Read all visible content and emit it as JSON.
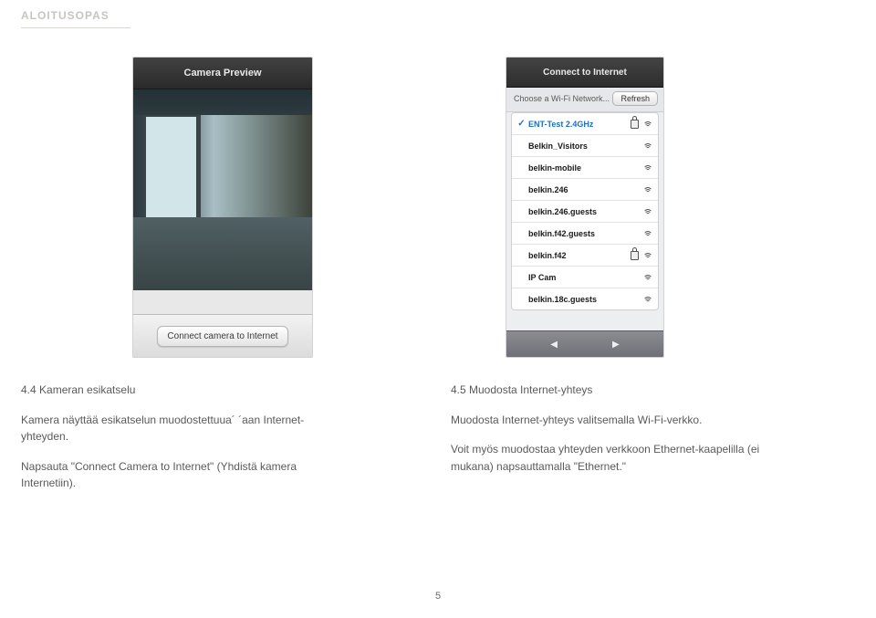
{
  "header": "ALOITUSOPAS",
  "pageNumber": "5",
  "leftShot": {
    "title": "Camera Preview",
    "button": "Connect camera to Internet"
  },
  "rightShot": {
    "title": "Connect to Internet",
    "chooseLabel": "Choose a Wi-Fi Network...",
    "refresh": "Refresh",
    "navPrev": "◀",
    "navNext": "▶",
    "networks": [
      {
        "name": "ENT-Test 2.4GHz",
        "selected": true,
        "lock": true
      },
      {
        "name": "Belkin_Visitors",
        "selected": false,
        "lock": false
      },
      {
        "name": "belkin-mobile",
        "selected": false,
        "lock": false
      },
      {
        "name": "belkin.246",
        "selected": false,
        "lock": false
      },
      {
        "name": "belkin.246.guests",
        "selected": false,
        "lock": false
      },
      {
        "name": "belkin.f42.guests",
        "selected": false,
        "lock": false
      },
      {
        "name": "belkin.f42",
        "selected": false,
        "lock": true
      },
      {
        "name": "IP Cam",
        "selected": false,
        "lock": false
      },
      {
        "name": "belkin.18c.guests",
        "selected": false,
        "lock": false
      }
    ]
  },
  "left": {
    "h": "4.4 Kameran esikatselu",
    "p1": "Kamera näyttää esikatselun muodostettuua´ ´aan Internet-yhteyden.",
    "p2": "Napsauta \"Connect Camera to Internet\" (Yhdistä kamera Internetiin)."
  },
  "right": {
    "h": "4.5 Muodosta Internet-yhteys",
    "p1": "Muodosta Internet-yhteys valitsemalla Wi-Fi-verkko.",
    "p2": "Voit myös muodostaa yhteyden verkkoon Ethernet-kaapelilla (ei mukana) napsauttamalla \"Ethernet.\""
  }
}
